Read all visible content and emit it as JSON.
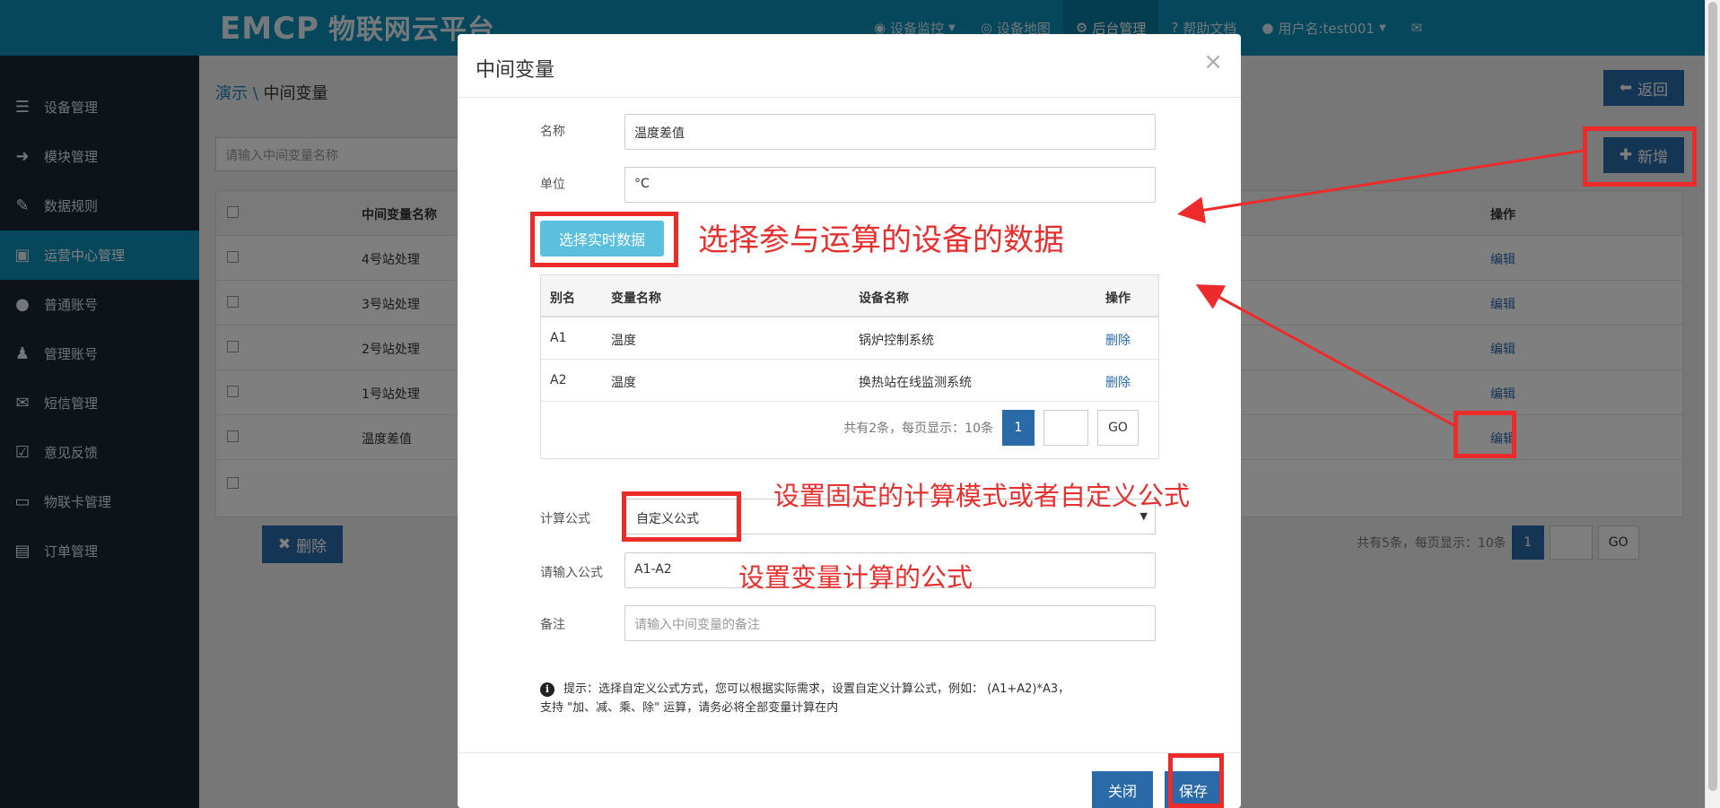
{
  "header": {
    "logo_text": "EMCP",
    "logo_cn": "物联网云平台",
    "nav": [
      {
        "label": "设备监控",
        "icon": "monitor-icon",
        "has_caret": true
      },
      {
        "label": "设备地图",
        "icon": "globe-icon",
        "has_caret": false
      },
      {
        "label": "后台管理",
        "icon": "gears-icon",
        "has_caret": false,
        "active": true
      },
      {
        "label": "帮助文档",
        "icon": "question-icon",
        "has_caret": false
      },
      {
        "label": "用户名:test001",
        "icon": "user-icon",
        "has_caret": true
      },
      {
        "label": "",
        "icon": "mail-icon",
        "has_caret": false
      }
    ]
  },
  "sidebar": {
    "items": [
      {
        "label": "设备管理",
        "icon": "list-icon"
      },
      {
        "label": "模块管理",
        "icon": "sign-in-icon"
      },
      {
        "label": "数据规则",
        "icon": "pencil-icon"
      },
      {
        "label": "运营中心管理",
        "icon": "dashboard-icon",
        "active": true
      },
      {
        "label": "普通账号",
        "icon": "user-icon"
      },
      {
        "label": "管理账号",
        "icon": "admin-icon"
      },
      {
        "label": "短信管理",
        "icon": "envelope-icon"
      },
      {
        "label": "意见反馈",
        "icon": "edit-icon"
      },
      {
        "label": "物联卡管理",
        "icon": "card-icon"
      },
      {
        "label": "订单管理",
        "icon": "order-icon"
      }
    ]
  },
  "background": {
    "breadcrumb_root": "演示 \\",
    "breadcrumb_current": "中间变量",
    "back_label": "返回",
    "search_placeholder": "请输入中间变量名称",
    "add_label": "新增",
    "table_header_name": "中间变量名称",
    "table_header_op": "操作",
    "rows": [
      {
        "name": "4号站处理",
        "op": "编辑"
      },
      {
        "name": "3号站处理",
        "op": "编辑"
      },
      {
        "name": "2号站处理",
        "op": "编辑"
      },
      {
        "name": "1号站处理",
        "op": "编辑"
      },
      {
        "name": "温度差值",
        "op": "编辑"
      }
    ],
    "delete_label": "删除",
    "pager_text": "共有5条，每页显示：10条",
    "pager_current": "1",
    "pager_go": "GO"
  },
  "modal": {
    "title": "中间变量",
    "close_glyph": "×",
    "name_label": "名称",
    "name_value": "温度差值",
    "unit_label": "单位",
    "unit_value": "°C",
    "select_data_label": "选择实时数据",
    "table_headers": [
      "别名",
      "变量名称",
      "设备名称",
      "操作"
    ],
    "table_rows": [
      {
        "alias": "A1",
        "var": "温度",
        "device": "锅炉控制系统",
        "op": "删除"
      },
      {
        "alias": "A2",
        "var": "温度",
        "device": "换热站在线监测系统",
        "op": "删除"
      }
    ],
    "pager_text": "共有2条，每页显示：10条",
    "pager_current": "1",
    "pager_go": "GO",
    "formula_type_label": "计算公式",
    "formula_type_value": "自定义公式",
    "formula_label": "请输入公式",
    "formula_value": "A1-A2",
    "remark_label": "备注",
    "remark_placeholder": "请输入中间变量的备注",
    "tip_line1": "提示：选择自定义公式方式，您可以根据实际需求，设置自定义计算公式，例如：  (A1+A2)*A3，",
    "tip_line2": "支持 \"加、减、乘、除\" 运算，请务必将全部变量计算在内",
    "close_button": "关闭",
    "save_button": "保存"
  },
  "annotations": {
    "select_data_note": "选择参与运算的设备的数据",
    "formula_type_note": "设置固定的计算模式或者自定义公式",
    "formula_note": "设置变量计算的公式",
    "highlight_color": "#ee2b2b"
  }
}
